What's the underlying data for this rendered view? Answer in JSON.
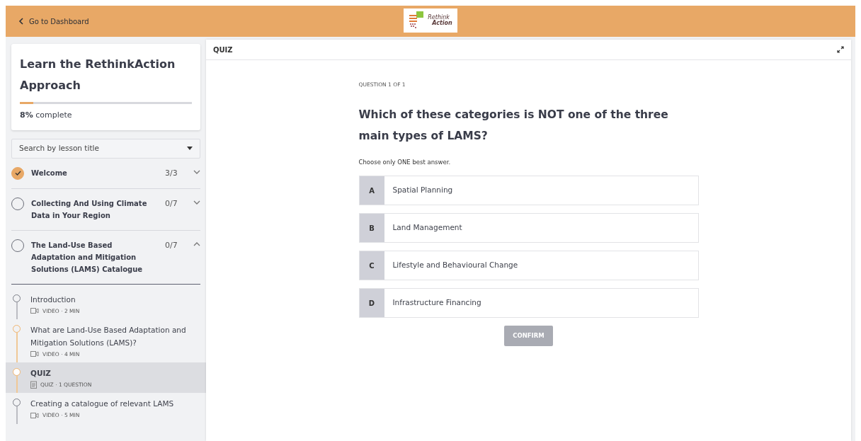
{
  "header": {
    "back_link": "Go to Dashboard",
    "logo": {
      "line_1": "Rethink",
      "line_2": "Action"
    }
  },
  "course": {
    "title": "Learn the RethinkAction Approach",
    "progress": {
      "level": 0.08,
      "percent": "8%",
      "label": "complete"
    }
  },
  "search": {
    "placeholder": "Search by lesson title"
  },
  "sections": [
    {
      "title": "Welcome",
      "count": "3/3",
      "completed": true,
      "expanded": false
    },
    {
      "title": "Collecting And Using Climate Data in Your Region",
      "count": "0/7",
      "completed": false,
      "expanded": false
    },
    {
      "title": "The Land-Use Based Adaptation and Mitigation Solutions (LAMS) Catalogue",
      "count": "0/7",
      "completed": false,
      "expanded": true,
      "lessons": [
        {
          "title": "Introduction",
          "kind": "video",
          "meta": "VIDEO · 2 MIN",
          "started": false,
          "selected": false
        },
        {
          "title": "What are Land-Use Based Adaptation and Mitigation Solutions (LAMS)?",
          "kind": "video",
          "meta": "VIDEO · 4 MIN",
          "started": true,
          "selected": false
        },
        {
          "title": "QUIZ",
          "kind": "quiz",
          "meta": "QUIZ · 1 QUESTION",
          "started": true,
          "selected": true
        },
        {
          "title": "Creating a catalogue of relevant LAMS",
          "kind": "video",
          "meta": "VIDEO · 5 MIN",
          "started": false,
          "selected": false
        }
      ]
    }
  ],
  "quiz": {
    "title": "QUIZ",
    "counter": "QUESTION 1 OF 1",
    "question": "Which of these categories is NOT one of the three main types of LAMS?",
    "instruction": "Choose only ONE best answer.",
    "answers": [
      {
        "letter": "A",
        "text": "Spatial Planning",
        "selected": false
      },
      {
        "letter": "B",
        "text": "Land Management",
        "selected": false
      },
      {
        "letter": "C",
        "text": "Lifestyle and Behavioural Change",
        "selected": false
      },
      {
        "letter": "D",
        "text": "Infrastructure Financing",
        "selected": false
      }
    ],
    "confirm": {
      "label": "CONFIRM",
      "disabled": true
    }
  }
}
